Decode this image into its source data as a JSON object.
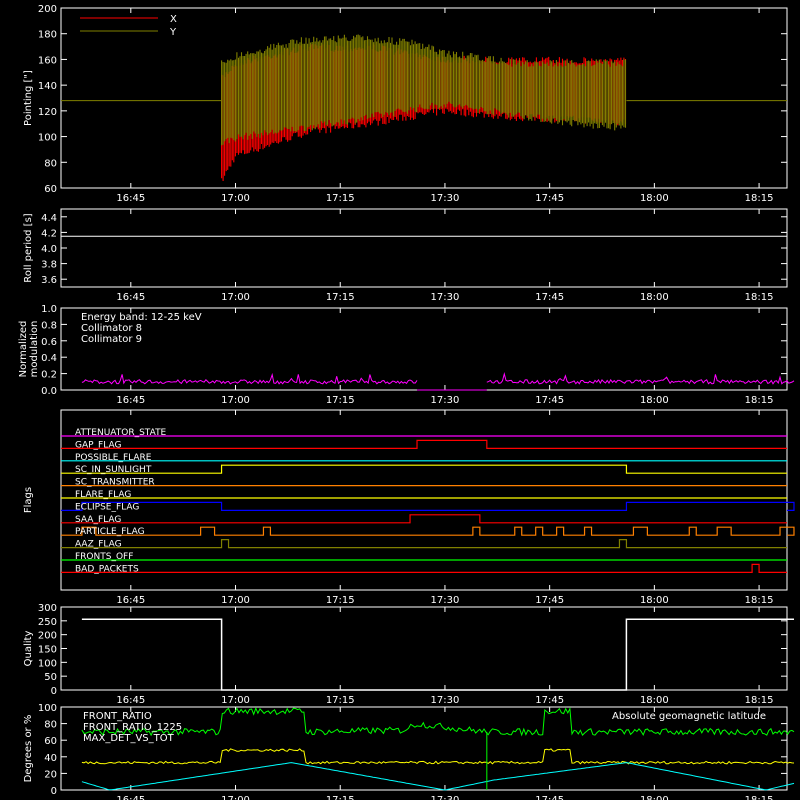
{
  "x_ticks": [
    "16:45",
    "17:00",
    "17:15",
    "17:30",
    "17:45",
    "18:00",
    "18:15"
  ],
  "x_tick_minutes": [
    1005,
    1020,
    1035,
    1050,
    1065,
    1080,
    1095
  ],
  "x_range_minutes": [
    995,
    1099
  ],
  "colors": {
    "bg": "#000000",
    "axis": "#ffffff",
    "red": "#ff0000",
    "olive": "#808000",
    "cyan": "#00ffff",
    "magenta": "#ff00ff",
    "green": "#00ff00",
    "yellow": "#ffff00",
    "blue": "#0000ff",
    "orange": "#ff8000"
  },
  "chart_data": [
    {
      "type": "line",
      "ylabel": "Pointing [\"]",
      "ylim": [
        60,
        200
      ],
      "yticks": [
        60,
        80,
        100,
        120,
        140,
        160,
        180,
        200
      ],
      "legend": [
        {
          "name": "X",
          "color": "#ff0000"
        },
        {
          "name": "Y",
          "color": "#808000"
        }
      ],
      "legend_placement": "top-left",
      "active_interval": [
        "16:58",
        "17:56"
      ],
      "baseline": 128,
      "series": [
        {
          "name": "X",
          "color": "#ff0000",
          "envelope_time": [
            "16:58",
            "17:00",
            "17:10",
            "17:20",
            "17:30",
            "17:40",
            "17:50",
            "17:56"
          ],
          "upper": [
            148,
            160,
            172,
            172,
            163,
            162,
            162,
            162
          ],
          "lower": [
            62,
            82,
            100,
            108,
            117,
            112,
            110,
            108
          ]
        },
        {
          "name": "Y",
          "color": "#808000",
          "envelope_time": [
            "16:58",
            "17:00",
            "17:10",
            "17:17",
            "17:25",
            "17:30",
            "17:40",
            "17:50",
            "17:56"
          ],
          "upper": [
            160,
            166,
            178,
            180,
            176,
            168,
            160,
            160,
            160
          ],
          "lower": [
            92,
            96,
            104,
            110,
            118,
            122,
            114,
            106,
            104
          ]
        }
      ]
    },
    {
      "type": "line",
      "ylabel": "Roll period [s]",
      "ylim": [
        3.5,
        4.5
      ],
      "yticks": [
        3.6,
        3.8,
        4.0,
        4.2,
        4.4
      ],
      "series": [
        {
          "name": "Roll period",
          "color": "#ffffff",
          "x": [
            "16:38",
            "18:20"
          ],
          "values": [
            4.15,
            4.15
          ]
        }
      ]
    },
    {
      "type": "line",
      "ylabel": "Normalized modulation",
      "ylim": [
        0,
        1.0
      ],
      "yticks": [
        0.0,
        0.2,
        0.4,
        0.6,
        0.8,
        1.0
      ],
      "legend": [
        {
          "name": "Energy band: 12-25 keV",
          "color": "#ffffff"
        },
        {
          "name": "Collimator 8",
          "color": "#00ffff"
        },
        {
          "name": "Collimator 9",
          "color": "#ff00ff"
        }
      ],
      "legend_placement": "top-left",
      "series": [
        {
          "name": "Collimator 9",
          "color": "#ff00ff",
          "typical_value": 0.1,
          "segments": [
            [
              "16:38",
              "17:26"
            ],
            [
              "17:36",
              "18:20"
            ]
          ],
          "gap_value": 0
        }
      ]
    },
    {
      "type": "line",
      "ylabel": "Flags",
      "flags": [
        {
          "name": "ATTENUATOR_STATE",
          "color": "#ff00ff",
          "high_intervals": []
        },
        {
          "name": "GAP_FLAG",
          "color": "#ff0000",
          "high_intervals": [
            [
              "17:26",
              "17:36"
            ]
          ]
        },
        {
          "name": "POSSIBLE_FLARE",
          "color": "#00ffff",
          "high_intervals": []
        },
        {
          "name": "SC_IN_SUNLIGHT",
          "color": "#ffff00",
          "high_intervals": [
            [
              "16:58",
              "17:56"
            ]
          ]
        },
        {
          "name": "SC_TRANSMITTER",
          "color": "#ff8000",
          "high_intervals": []
        },
        {
          "name": "FLARE_FLAG",
          "color": "#ffff00",
          "high_intervals": []
        },
        {
          "name": "ECLIPSE_FLAG",
          "color": "#0000ff",
          "high_intervals": [
            [
              "16:38",
              "16:58"
            ],
            [
              "17:56",
              "18:20"
            ]
          ]
        },
        {
          "name": "SAA_FLAG",
          "color": "#ff0000",
          "high_intervals": [
            [
              "17:25",
              "17:35"
            ]
          ]
        },
        {
          "name": "PARTICLE_FLAG",
          "color": "#ff8000",
          "high_intervals": [
            [
              "16:38",
              "16:40"
            ],
            [
              "16:55",
              "16:57"
            ],
            [
              "17:04",
              "17:05"
            ],
            [
              "17:34",
              "17:35"
            ],
            [
              "17:40",
              "17:41"
            ],
            [
              "17:43",
              "17:44"
            ],
            [
              "17:46",
              "17:47"
            ],
            [
              "17:50",
              "17:51"
            ],
            [
              "17:57",
              "17:59"
            ],
            [
              "18:05",
              "18:06"
            ],
            [
              "18:09",
              "18:11"
            ],
            [
              "18:18",
              "18:20"
            ]
          ]
        },
        {
          "name": "AAZ_FLAG",
          "color": "#808000",
          "high_intervals": [
            [
              "16:58",
              "16:59"
            ],
            [
              "17:55",
              "17:56"
            ]
          ]
        },
        {
          "name": "FRONTS_OFF",
          "color": "#00ff00",
          "high_intervals": []
        },
        {
          "name": "BAD_PACKETS",
          "color": "#ff0000",
          "high_intervals": [
            [
              "18:14",
              "18:15"
            ]
          ]
        }
      ]
    },
    {
      "type": "line",
      "ylabel": "Quality",
      "ylim": [
        0,
        300
      ],
      "yticks": [
        0,
        50,
        100,
        150,
        200,
        250,
        300
      ],
      "series": [
        {
          "name": "Quality",
          "color": "#ffffff",
          "x": [
            "16:38",
            "16:58",
            "16:58",
            "17:56",
            "17:56",
            "18:20"
          ],
          "values": [
            256,
            256,
            0,
            0,
            256,
            256
          ]
        }
      ]
    },
    {
      "type": "line",
      "ylabel": "Degrees or %",
      "ylim": [
        0,
        100
      ],
      "yticks": [
        0,
        20,
        40,
        60,
        80,
        100
      ],
      "legend": [
        {
          "name": "FRONT_RATIO",
          "color": "#ffff00"
        },
        {
          "name": "FRONT_RATIO_1225",
          "color": "#00ff00"
        },
        {
          "name": "MAX_DET_VS_TOT",
          "color": "#ff8000"
        },
        {
          "name": "Absolute geomagnetic latitude",
          "color": "#00ffff"
        }
      ],
      "legend_placement": "top-left; top-right",
      "series": [
        {
          "name": "FRONT_RATIO_1225",
          "color": "#00ff00",
          "x": [
            "16:38",
            "16:58",
            "16:58",
            "17:10",
            "17:10",
            "17:24",
            "17:26",
            "17:36",
            "17:44",
            "17:44",
            "17:48",
            "17:48",
            "18:20"
          ],
          "values": [
            70,
            70,
            95,
            95,
            70,
            72,
            80,
            70,
            70,
            95,
            95,
            70,
            70
          ]
        },
        {
          "name": "FRONT_RATIO",
          "color": "#ffff00",
          "x": [
            "16:38",
            "16:58",
            "16:58",
            "17:10",
            "17:10",
            "17:26",
            "17:36",
            "17:44",
            "17:44",
            "17:48",
            "17:48",
            "18:20"
          ],
          "values": [
            33,
            33,
            48,
            48,
            33,
            33,
            33,
            33,
            48,
            48,
            33,
            33
          ]
        },
        {
          "name": "Absolute geomagnetic latitude",
          "color": "#00ffff",
          "x": [
            "16:38",
            "16:42",
            "17:08",
            "17:30",
            "17:37",
            "17:56",
            "18:16",
            "18:20"
          ],
          "values": [
            10,
            0,
            33,
            0,
            12,
            33,
            0,
            8
          ]
        }
      ]
    }
  ]
}
